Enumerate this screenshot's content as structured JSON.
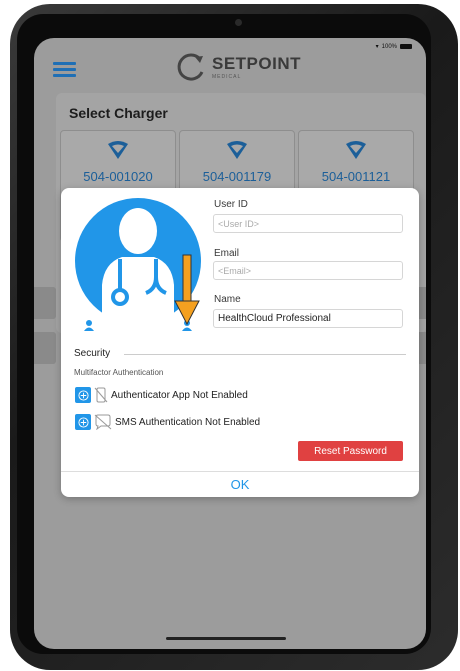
{
  "app": {
    "brand": "SETPOINT",
    "brand_sub": "MEDICAL",
    "battery_text": "100%",
    "section_title": "Select Charger",
    "chargers": [
      {
        "id": "504-001020"
      },
      {
        "id": "504-001179"
      },
      {
        "id": "504-001121"
      }
    ]
  },
  "dialog": {
    "user_id_label": "User ID",
    "user_id_placeholder": "<User ID>",
    "email_label": "Email",
    "email_placeholder": "<Email>",
    "name_label": "Name",
    "name_value": "HealthCloud Professional",
    "security_title": "Security",
    "mfa_title": "Multifactor Authentication",
    "mfa_items": [
      {
        "label": "Authenticator App Not Enabled",
        "icon": "phone-slash-icon"
      },
      {
        "label": "SMS Authentication Not Enabled",
        "icon": "chat-slash-icon"
      }
    ],
    "reset_label": "Reset Password",
    "ok_label": "OK"
  },
  "colors": {
    "accent": "#2196e8",
    "danger": "#e04141",
    "arrow": "#f4a020"
  }
}
